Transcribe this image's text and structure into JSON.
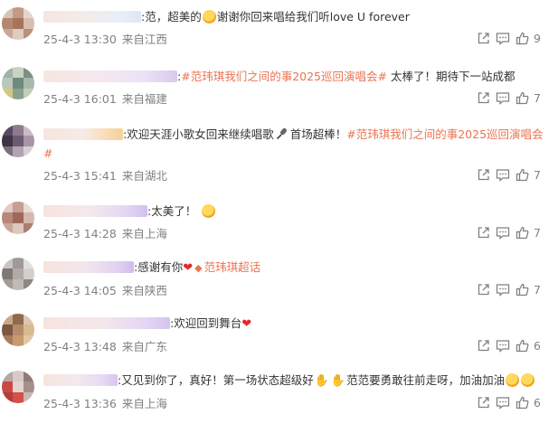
{
  "comments": [
    {
      "separator": ":",
      "text_1": "范，超美的",
      "text_2": "谢谢你回来唱给我们听love U forever",
      "date": "25-4-3 13:30",
      "location": "来自江西",
      "likes": "9"
    },
    {
      "separator": ":",
      "hashtag": "#范玮琪我们之间的事2025巡回演唱会#",
      "text_1": " 太棒了！期待下一站成都",
      "date": "25-4-3 16:01",
      "location": "来自福建",
      "likes": "7"
    },
    {
      "separator": ":",
      "text_1": "欢迎天涯小歌女回来继续唱歌",
      "text_2": "首场超棒！",
      "hashtag": "#范玮琪我们之间的事2025巡回演唱会#",
      "date": "25-4-3 15:41",
      "location": "来自湖北",
      "likes": "7"
    },
    {
      "separator": ":",
      "text_1": "太美了！",
      "date": "25-4-3 14:28",
      "location": "来自上海",
      "likes": "7"
    },
    {
      "separator": ":",
      "text_1": "感谢有你",
      "mention": "范玮琪超话",
      "date": "25-4-3 14:05",
      "location": "来自陕西",
      "likes": "7"
    },
    {
      "separator": ":",
      "text_1": "欢迎回到舞台",
      "date": "25-4-3 13:48",
      "location": "来自广东",
      "likes": "6"
    },
    {
      "separator": ":",
      "text_1": "又见到你了，真好！第一场状态超级好",
      "text_2": "范范要勇敢往前走呀，加油加油",
      "date": "25-4-3 13:36",
      "location": "来自上海",
      "likes": "6"
    }
  ],
  "colors": {
    "hashtag": "#eb7350",
    "meta": "#808080",
    "heart": "#e8252b"
  },
  "icons": {
    "share": "share-icon",
    "comment": "comment-icon",
    "like": "thumbs-up-icon"
  }
}
